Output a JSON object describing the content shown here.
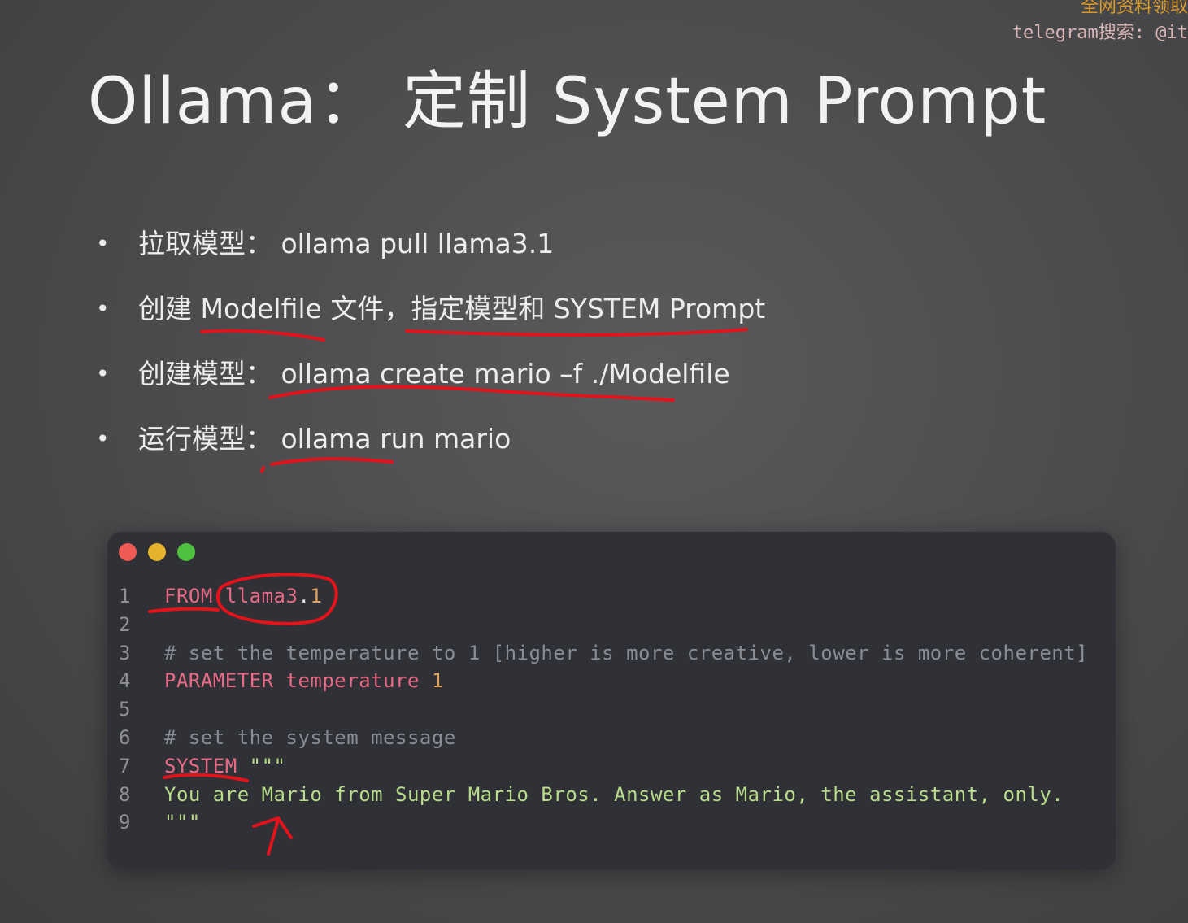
{
  "watermark": {
    "line1": "全网资料领取",
    "line2": "telegram搜索: @it"
  },
  "slide": {
    "title": "Ollama： 定制 System Prompt",
    "bullets": [
      "拉取模型： ollama pull llama3.1",
      "创建 Modelfile 文件，指定模型和 SYSTEM Prompt",
      "创建模型： ollama create mario –f ./Modelfile",
      "运行模型： ollama run mario"
    ]
  },
  "code_window": {
    "controls": [
      "close-dot",
      "minimize-dot",
      "maximize-dot"
    ],
    "line_numbers": [
      "1",
      "2",
      "3",
      "4",
      "5",
      "6",
      "7",
      "8",
      "9"
    ],
    "lines": [
      [
        {
          "t": "kw",
          "v": "FROM"
        },
        {
          "t": "plain",
          "v": " "
        },
        {
          "t": "kw",
          "v": "llama3"
        },
        {
          "t": "plain",
          "v": "."
        },
        {
          "t": "num",
          "v": "1"
        }
      ],
      [],
      [
        {
          "t": "cm",
          "v": "# set the temperature to 1 [higher is more creative, lower is more coherent]"
        }
      ],
      [
        {
          "t": "kw",
          "v": "PARAMETER"
        },
        {
          "t": "plain",
          "v": " "
        },
        {
          "t": "kw",
          "v": "temperature"
        },
        {
          "t": "plain",
          "v": " "
        },
        {
          "t": "num",
          "v": "1"
        }
      ],
      [],
      [
        {
          "t": "cm",
          "v": "# set the system message"
        }
      ],
      [
        {
          "t": "kw",
          "v": "SYSTEM"
        },
        {
          "t": "plain",
          "v": " "
        },
        {
          "t": "str",
          "v": "\"\"\""
        }
      ],
      [
        {
          "t": "str",
          "v": "You are Mario from Super Mario Bros. Answer as Mario, the assistant, only."
        }
      ],
      [
        {
          "t": "str",
          "v": "\"\"\""
        }
      ]
    ]
  },
  "colors": {
    "keyword": "#e86a86",
    "string": "#b8dc8a",
    "number": "#e0a45f",
    "comment": "#8a8d95",
    "annotation": "#e3121b"
  }
}
